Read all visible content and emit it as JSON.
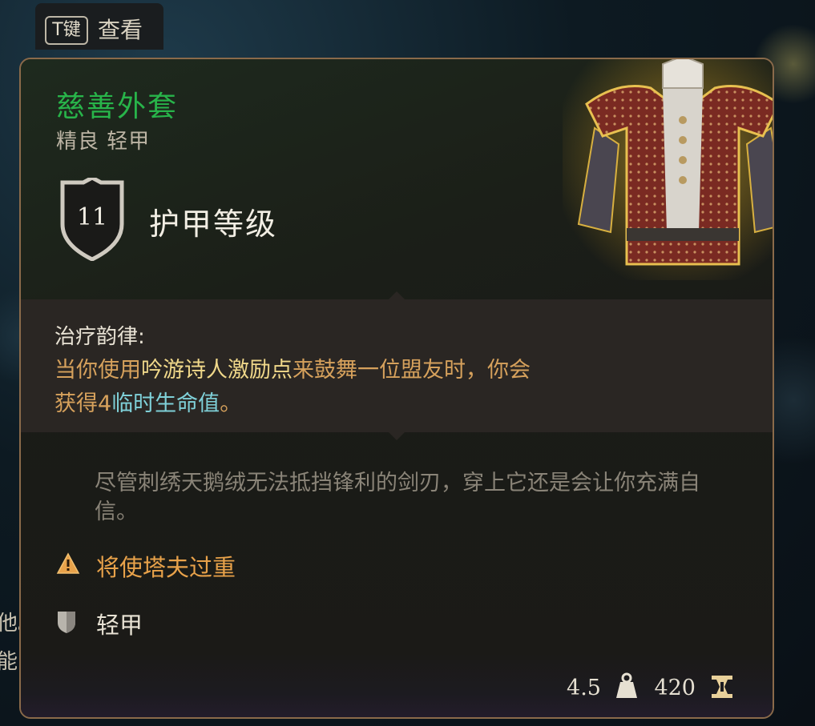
{
  "key_hint": {
    "key": "T键",
    "label": "查看"
  },
  "item": {
    "name": "慈善外套",
    "subtitle": "精良 轻甲",
    "armor_class_value": "11",
    "armor_class_label": "护甲等级",
    "art_icon": "jacket-icon"
  },
  "passive": {
    "title": "治疗韵律:",
    "line1_pre": "当你使用",
    "line1_hl": "吟游诗人激励点",
    "line1_post": "来鼓舞一位盟友时，你会",
    "line2_pre": "获得4",
    "line2_hl": "临时生命值",
    "line2_post": "。"
  },
  "flavor": "尽管刺绣天鹅绒无法抵挡锋利的剑刃，穿上它还是会让你充满自信。",
  "warning": {
    "icon": "warning-icon",
    "text": "将使塔夫过重"
  },
  "tag": {
    "icon": "light-armor-shield-icon",
    "text": "轻甲"
  },
  "footer": {
    "weight": "4.5",
    "weight_icon": "weight-icon",
    "price": "420",
    "price_icon": "gold-coin-icon"
  },
  "background_text": [
    "他。",
    "能"
  ],
  "colors": {
    "rarity_green": "#28b44a",
    "passive_orange": "#d6a15c",
    "highlight_yellow": "#f0d88a",
    "highlight_cyan": "#7fd0d8",
    "warning_orange": "#e8a24a",
    "border": "#8a6a4a"
  }
}
